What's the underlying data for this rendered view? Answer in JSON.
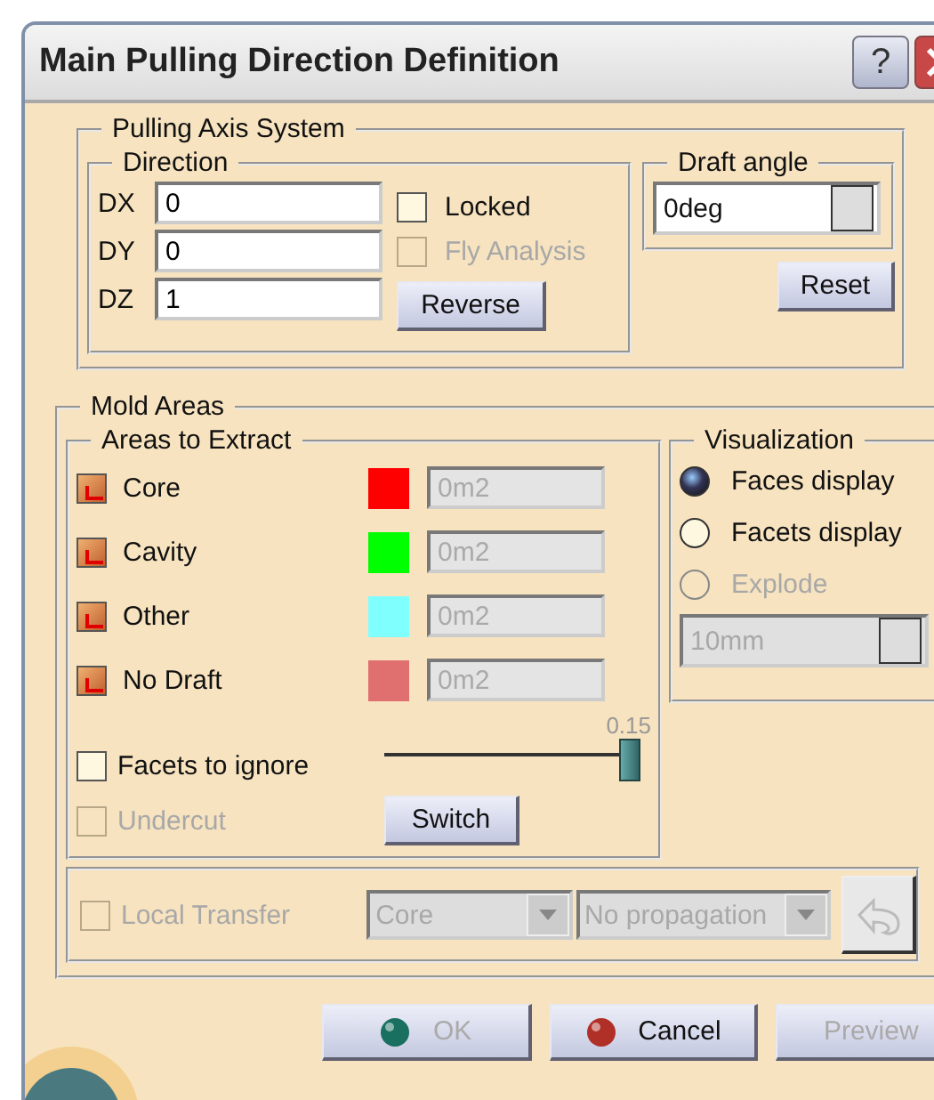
{
  "window": {
    "title": "Main Pulling Direction Definition",
    "help_button": "?"
  },
  "pulling_axis_system": {
    "title": "Pulling Axis System",
    "direction": {
      "title": "Direction",
      "fields": [
        {
          "label": "DX",
          "value": "0"
        },
        {
          "label": "DY",
          "value": "0"
        },
        {
          "label": "DZ",
          "value": "1"
        }
      ],
      "locked": {
        "label": "Locked",
        "checked": false,
        "disabled": false
      },
      "fly_analysis": {
        "label": "Fly Analysis",
        "checked": false,
        "disabled": true
      },
      "reverse_button": "Reverse"
    },
    "draft_angle": {
      "title": "Draft angle",
      "value": "0deg",
      "reset_button": "Reset"
    }
  },
  "mold_areas": {
    "title": "Mold Areas",
    "areas_to_extract": {
      "title": "Areas to Extract",
      "rows": [
        {
          "label": "Core",
          "checked": true,
          "color": "#ff0000",
          "value": "0m2"
        },
        {
          "label": "Cavity",
          "checked": true,
          "color": "#00ff00",
          "value": "0m2"
        },
        {
          "label": "Other",
          "checked": true,
          "color": "#80ffff",
          "value": "0m2"
        },
        {
          "label": "No Draft",
          "checked": true,
          "color": "#e07070",
          "value": "0m2"
        }
      ],
      "facets_to_ignore": {
        "label": "Facets to ignore",
        "checked": false,
        "level": 1,
        "reading": "0.15"
      },
      "undercut": {
        "label": "Undercut",
        "checked": false,
        "disabled": true
      },
      "switch_button": "Switch"
    },
    "visualization": {
      "title": "Visualization",
      "options": [
        {
          "label": "Faces display",
          "selected": true,
          "disabled": false
        },
        {
          "label": "Facets display",
          "selected": false,
          "disabled": false
        },
        {
          "label": "Explode",
          "selected": false,
          "disabled": true
        }
      ],
      "explode_value": "10mm"
    },
    "local_transfer": {
      "label": "Local Transfer",
      "checked": false,
      "disabled": true,
      "zone": "Core",
      "propagation": "No propagation"
    }
  },
  "buttons": [
    {
      "kind": "ok",
      "label": "OK",
      "disabled": true
    },
    {
      "kind": "cancel",
      "label": "Cancel",
      "disabled": false
    },
    {
      "kind": "plain",
      "label": "Preview",
      "disabled": true
    }
  ]
}
